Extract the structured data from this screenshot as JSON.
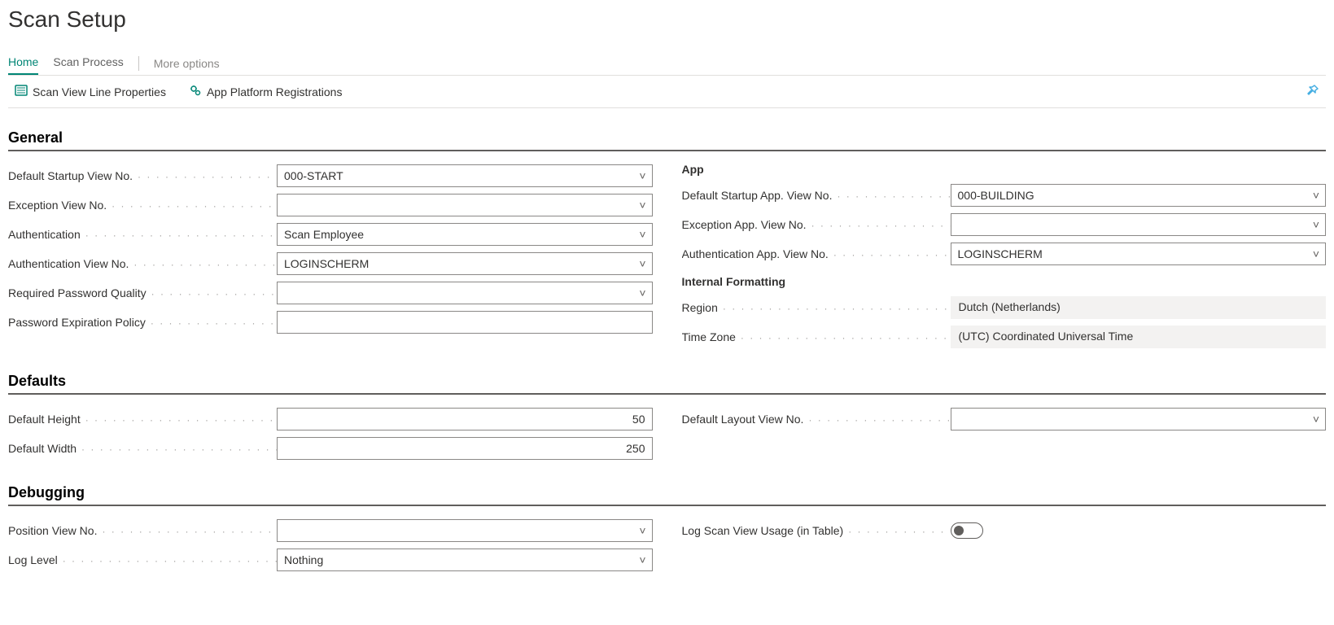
{
  "title": "Scan Setup",
  "tabs": {
    "home": "Home",
    "scan_process": "Scan Process",
    "more": "More options"
  },
  "actions": {
    "scan_view_line_properties": "Scan View Line Properties",
    "app_platform_registrations": "App Platform Registrations"
  },
  "sections": {
    "general": "General",
    "defaults": "Defaults",
    "debugging": "Debugging"
  },
  "general": {
    "labels": {
      "default_startup_view": "Default Startup View No.",
      "exception_view": "Exception View No.",
      "authentication": "Authentication",
      "authentication_view": "Authentication View No.",
      "required_password_quality": "Required Password Quality",
      "password_expiration_policy": "Password Expiration Policy",
      "app_heading": "App",
      "default_startup_app_view": "Default Startup App. View No.",
      "exception_app_view": "Exception App. View No.",
      "authentication_app_view": "Authentication App. View No.",
      "internal_formatting_heading": "Internal Formatting",
      "region": "Region",
      "time_zone": "Time Zone"
    },
    "values": {
      "default_startup_view": "000-START",
      "exception_view": "",
      "authentication": "Scan Employee",
      "authentication_view": "LOGINSCHERM",
      "required_password_quality": "",
      "password_expiration_policy": "",
      "default_startup_app_view": "000-BUILDING",
      "exception_app_view": "",
      "authentication_app_view": "LOGINSCHERM",
      "region": "Dutch (Netherlands)",
      "time_zone": "(UTC) Coordinated Universal Time"
    }
  },
  "defaults": {
    "labels": {
      "default_height": "Default Height",
      "default_width": "Default Width",
      "default_layout_view": "Default Layout View No."
    },
    "values": {
      "default_height": "50",
      "default_width": "250",
      "default_layout_view": ""
    }
  },
  "debugging": {
    "labels": {
      "position_view": "Position View No.",
      "log_level": "Log Level",
      "log_scan_view_usage": "Log Scan View Usage (in Table)"
    },
    "values": {
      "position_view": "",
      "log_level": "Nothing",
      "log_scan_view_usage": false
    }
  }
}
